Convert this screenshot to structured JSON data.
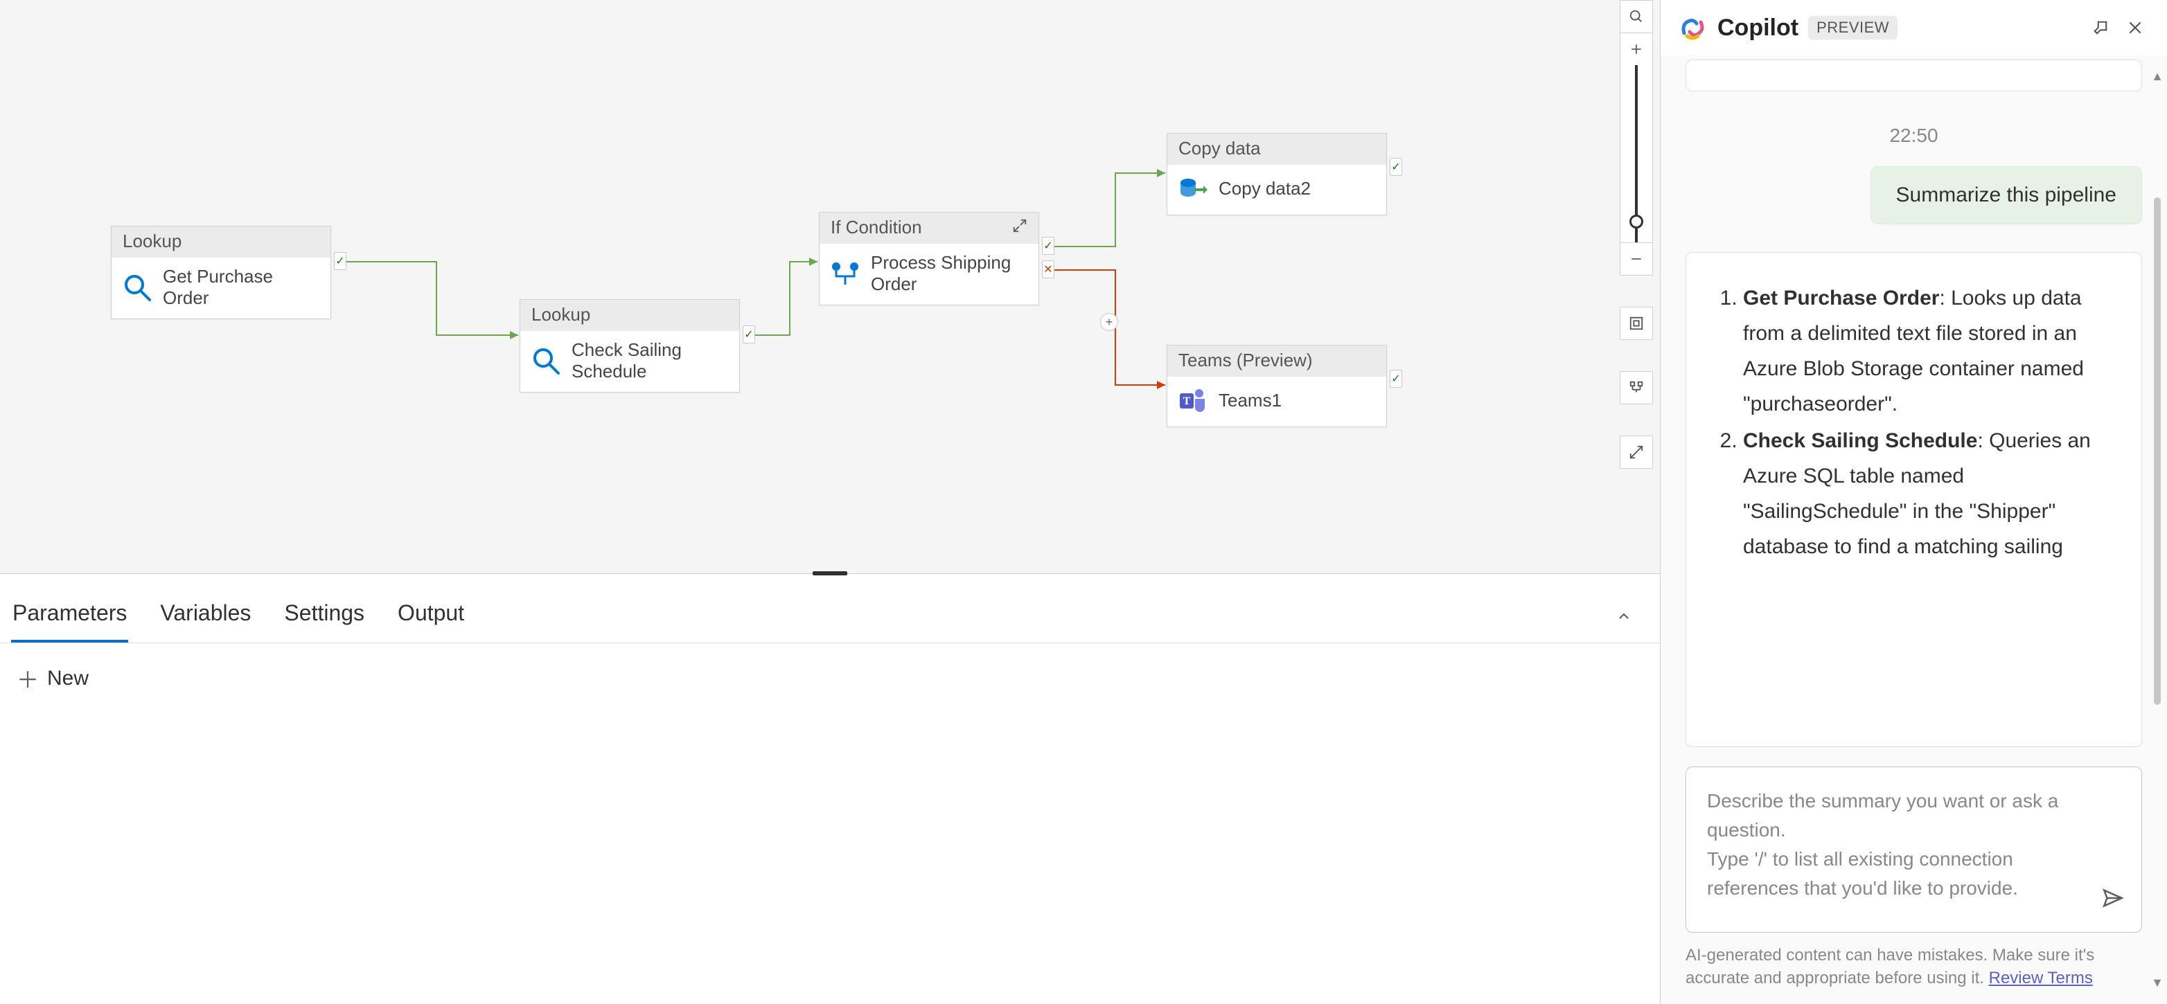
{
  "canvas": {
    "activities": {
      "a1": {
        "type": "Lookup",
        "title": "Get Purchase Order"
      },
      "a2": {
        "type": "Lookup",
        "title": "Check Sailing Schedule"
      },
      "a3": {
        "type": "If Condition",
        "title": "Process Shipping Order"
      },
      "a4": {
        "type": "Copy data",
        "title": "Copy data2"
      },
      "a5": {
        "type": "Teams (Preview)",
        "title": "Teams1"
      }
    }
  },
  "bottomPanel": {
    "tabs": [
      "Parameters",
      "Variables",
      "Settings",
      "Output"
    ],
    "activeTab": 0,
    "newButton": "New"
  },
  "copilot": {
    "title": "Copilot",
    "badge": "PREVIEW",
    "timestamp": "22:50",
    "userMessage": "Summarize this pipeline",
    "assistant": {
      "items": [
        {
          "title": "Get Purchase Order",
          "body": ": Looks up data from a delimited text file stored in an Azure Blob Storage container named \"purchaseorder\"."
        },
        {
          "title": "Check Sailing Schedule",
          "body": ": Queries an Azure SQL table named \"SailingSchedule\" in the \"Shipper\" database to find a matching sailing"
        }
      ]
    },
    "inputPlaceholder": "Describe the summary you want or ask a question.\nType '/' to list all existing connection references that you'd like to provide.",
    "footer": "AI-generated content can have mistakes. Make sure it's accurate and appropriate before using it. ",
    "footerLink": "Review Terms"
  }
}
